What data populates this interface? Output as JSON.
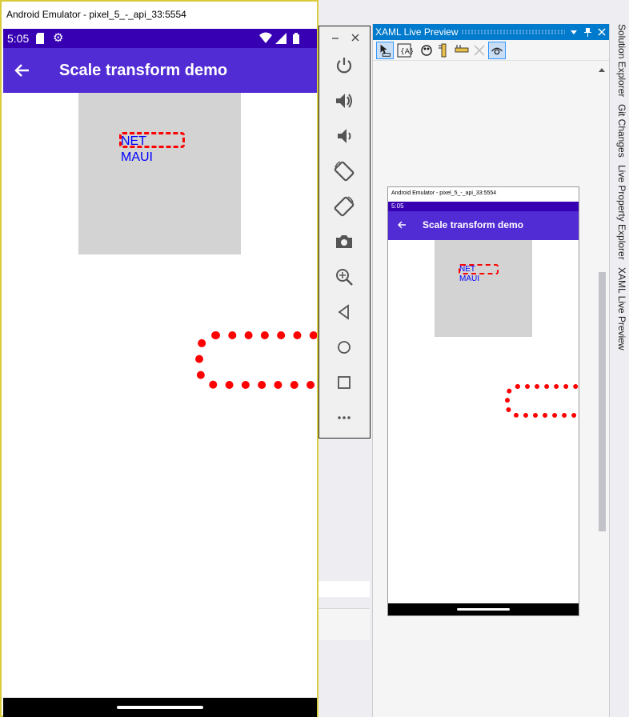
{
  "emulator": {
    "window_title": "Android Emulator - pixel_5_-_api_33:5554",
    "status_bar": {
      "time": "5:05"
    },
    "app_bar": {
      "title": "Scale transform demo"
    },
    "content": {
      "label_line1": "NET",
      "label_line2": "MAUI"
    },
    "toolbar": {
      "buttons": [
        "power-icon",
        "volume-up-icon",
        "volume-down-icon",
        "rotate-left-icon",
        "rotate-right-icon",
        "camera-icon",
        "zoom-icon",
        "back-icon",
        "home-icon",
        "overview-icon",
        "more-icon"
      ]
    }
  },
  "xaml_live_preview": {
    "title": "XAML Live Preview",
    "mini_window_title": "Android Emulator - pixel_5_-_api_33:5554",
    "mini_time": "5:05",
    "mini_app_title": "Scale transform demo",
    "mini_label_line1": "NET",
    "mini_label_line2": "MAUI"
  },
  "right_tabs": [
    "Solution Explorer",
    "Git Changes",
    "Live Property Explorer",
    "XAML Live Preview"
  ],
  "colors": {
    "status_bar": "#3700b3",
    "app_bar": "#512bd4",
    "label_text": "#0000ff",
    "dashed_border": "#ff0000",
    "box_fill": "#d3d3d3",
    "vs_accent": "#007acc"
  }
}
